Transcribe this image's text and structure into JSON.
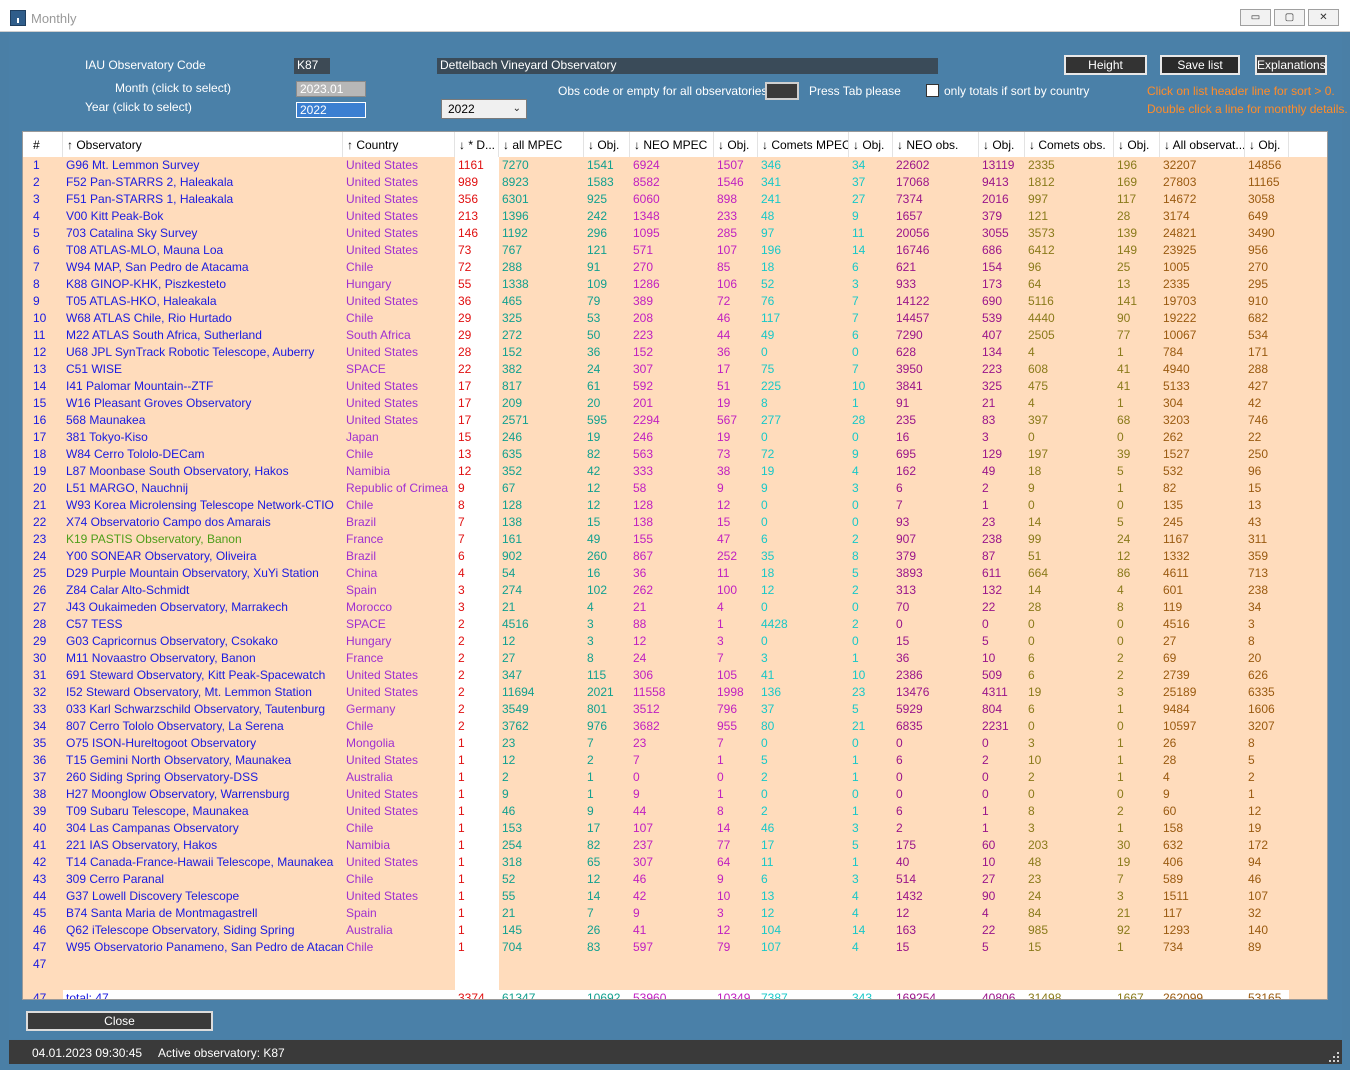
{
  "window": {
    "title": "Monthly",
    "min": "▭",
    "max": "▢",
    "close": "✕"
  },
  "form": {
    "code_label": "IAU Observatory Code",
    "code_value": "K87",
    "observatory_name": "Dettelbach Vineyard Observatory",
    "month_label": "Month (click to select)",
    "month_value": "2023.01",
    "year_label": "Year (click to select)",
    "year_value": "2022",
    "year_select": "2022",
    "obs_code_label": "Obs code or empty for all observatories",
    "press_tab": "Press Tab please",
    "totals_checkbox_label": "only totals if sort by country",
    "height_btn": "Height",
    "save_btn": "Save list",
    "explain_btn": "Explanations",
    "hint1": "Click on list header line for sort > 0.",
    "hint2": "Double click a line for monthly details."
  },
  "colors": {
    "row_bg": "#ffdcbc",
    "window_bg": "#4a80a8",
    "hint": "#ff8c2a"
  },
  "table": {
    "headers": [
      "#",
      "↑ Observatory",
      "↑ Country",
      "↓ * D...",
      "↓ all MPEC",
      "↓ Obj.",
      "↓ NEO MPEC",
      "↓ Obj.",
      "↓ Comets MPEC",
      "↓ Obj.",
      "↓ NEO obs.",
      "↓ Obj.",
      "↓ Comets obs.",
      "↓ Obj.",
      "↓ All observat...",
      "↓ Obj."
    ],
    "rows": [
      [
        "1",
        "G96  Mt. Lemmon Survey",
        "United States",
        "1161",
        "7270",
        "1541",
        "6924",
        "1507",
        "346",
        "34",
        "22602",
        "13119",
        "2335",
        "196",
        "32207",
        "14856"
      ],
      [
        "2",
        "F52  Pan-STARRS 2, Haleakala",
        "United States",
        "989",
        "8923",
        "1583",
        "8582",
        "1546",
        "341",
        "37",
        "17068",
        "9413",
        "1812",
        "169",
        "27803",
        "11165"
      ],
      [
        "3",
        "F51  Pan-STARRS 1, Haleakala",
        "United States",
        "356",
        "6301",
        "925",
        "6060",
        "898",
        "241",
        "27",
        "7374",
        "2016",
        "997",
        "117",
        "14672",
        "3058"
      ],
      [
        "4",
        "V00  Kitt Peak-Bok",
        "United States",
        "213",
        "1396",
        "242",
        "1348",
        "233",
        "48",
        "9",
        "1657",
        "379",
        "121",
        "28",
        "3174",
        "649"
      ],
      [
        "5",
        "703  Catalina Sky Survey",
        "United States",
        "146",
        "1192",
        "296",
        "1095",
        "285",
        "97",
        "11",
        "20056",
        "3055",
        "3573",
        "139",
        "24821",
        "3490"
      ],
      [
        "6",
        "T08  ATLAS-MLO, Mauna Loa",
        "United States",
        "73",
        "767",
        "121",
        "571",
        "107",
        "196",
        "14",
        "16746",
        "686",
        "6412",
        "149",
        "23925",
        "956"
      ],
      [
        "7",
        "W94  MAP, San Pedro de Atacama",
        "Chile",
        "72",
        "288",
        "91",
        "270",
        "85",
        "18",
        "6",
        "621",
        "154",
        "96",
        "25",
        "1005",
        "270"
      ],
      [
        "8",
        "K88  GINOP-KHK, Piszkesteto",
        "Hungary",
        "55",
        "1338",
        "109",
        "1286",
        "106",
        "52",
        "3",
        "933",
        "173",
        "64",
        "13",
        "2335",
        "295"
      ],
      [
        "9",
        "T05  ATLAS-HKO, Haleakala",
        "United States",
        "36",
        "465",
        "79",
        "389",
        "72",
        "76",
        "7",
        "14122",
        "690",
        "5116",
        "141",
        "19703",
        "910"
      ],
      [
        "10",
        "W68  ATLAS Chile, Rio Hurtado",
        "Chile",
        "29",
        "325",
        "53",
        "208",
        "46",
        "117",
        "7",
        "14457",
        "539",
        "4440",
        "90",
        "19222",
        "682"
      ],
      [
        "11",
        "M22  ATLAS South Africa, Sutherland",
        "South Africa",
        "29",
        "272",
        "50",
        "223",
        "44",
        "49",
        "6",
        "7290",
        "407",
        "2505",
        "77",
        "10067",
        "534"
      ],
      [
        "12",
        "U68  JPL SynTrack Robotic Telescope, Auberry",
        "United States",
        "28",
        "152",
        "36",
        "152",
        "36",
        "0",
        "0",
        "628",
        "134",
        "4",
        "1",
        "784",
        "171"
      ],
      [
        "13",
        "C51  WISE",
        "SPACE",
        "22",
        "382",
        "24",
        "307",
        "17",
        "75",
        "7",
        "3950",
        "223",
        "608",
        "41",
        "4940",
        "288"
      ],
      [
        "14",
        "I41  Palomar Mountain--ZTF",
        "United States",
        "17",
        "817",
        "61",
        "592",
        "51",
        "225",
        "10",
        "3841",
        "325",
        "475",
        "41",
        "5133",
        "427"
      ],
      [
        "15",
        "W16  Pleasant Groves Observatory",
        "United States",
        "17",
        "209",
        "20",
        "201",
        "19",
        "8",
        "1",
        "91",
        "21",
        "4",
        "1",
        "304",
        "42"
      ],
      [
        "16",
        "568  Maunakea",
        "United States",
        "17",
        "2571",
        "595",
        "2294",
        "567",
        "277",
        "28",
        "235",
        "83",
        "397",
        "68",
        "3203",
        "746"
      ],
      [
        "17",
        "381  Tokyo-Kiso",
        "Japan",
        "15",
        "246",
        "19",
        "246",
        "19",
        "0",
        "0",
        "16",
        "3",
        "0",
        "0",
        "262",
        "22"
      ],
      [
        "18",
        "W84  Cerro Tololo-DECam",
        "Chile",
        "13",
        "635",
        "82",
        "563",
        "73",
        "72",
        "9",
        "695",
        "129",
        "197",
        "39",
        "1527",
        "250"
      ],
      [
        "19",
        "L87  Moonbase South Observatory, Hakos",
        "Namibia",
        "12",
        "352",
        "42",
        "333",
        "38",
        "19",
        "4",
        "162",
        "49",
        "18",
        "5",
        "532",
        "96"
      ],
      [
        "20",
        "L51  MARGO, Nauchnij",
        "Republic of Crimea",
        "9",
        "67",
        "12",
        "58",
        "9",
        "9",
        "3",
        "6",
        "2",
        "9",
        "1",
        "82",
        "15"
      ],
      [
        "21",
        "W93  Korea Microlensing Telescope Network-CTIO",
        "Chile",
        "8",
        "128",
        "12",
        "128",
        "12",
        "0",
        "0",
        "7",
        "1",
        "0",
        "0",
        "135",
        "13"
      ],
      [
        "22",
        "X74  Observatorio Campo dos Amarais",
        "Brazil",
        "7",
        "138",
        "15",
        "138",
        "15",
        "0",
        "0",
        "93",
        "23",
        "14",
        "5",
        "245",
        "43"
      ],
      [
        "23",
        "K19  PASTIS Observatory, Banon",
        "France",
        "7",
        "161",
        "49",
        "155",
        "47",
        "6",
        "2",
        "907",
        "238",
        "99",
        "24",
        "1167",
        "311"
      ],
      [
        "24",
        "Y00  SONEAR Observatory, Oliveira",
        "Brazil",
        "6",
        "902",
        "260",
        "867",
        "252",
        "35",
        "8",
        "379",
        "87",
        "51",
        "12",
        "1332",
        "359"
      ],
      [
        "25",
        "D29  Purple Mountain Observatory, XuYi Station",
        "China",
        "4",
        "54",
        "16",
        "36",
        "11",
        "18",
        "5",
        "3893",
        "611",
        "664",
        "86",
        "4611",
        "713"
      ],
      [
        "26",
        "Z84  Calar Alto-Schmidt",
        "Spain",
        "3",
        "274",
        "102",
        "262",
        "100",
        "12",
        "2",
        "313",
        "132",
        "14",
        "4",
        "601",
        "238"
      ],
      [
        "27",
        "J43  Oukaimeden Observatory, Marrakech",
        "Morocco",
        "3",
        "21",
        "4",
        "21",
        "4",
        "0",
        "0",
        "70",
        "22",
        "28",
        "8",
        "119",
        "34"
      ],
      [
        "28",
        "C57  TESS",
        "SPACE",
        "2",
        "4516",
        "3",
        "88",
        "1",
        "4428",
        "2",
        "0",
        "0",
        "0",
        "0",
        "4516",
        "3"
      ],
      [
        "29",
        "G03  Capricornus Observatory, Csokako",
        "Hungary",
        "2",
        "12",
        "3",
        "12",
        "3",
        "0",
        "0",
        "15",
        "5",
        "0",
        "0",
        "27",
        "8"
      ],
      [
        "30",
        "M11  Novaastro Observatory, Banon",
        "France",
        "2",
        "27",
        "8",
        "24",
        "7",
        "3",
        "1",
        "36",
        "10",
        "6",
        "2",
        "69",
        "20"
      ],
      [
        "31",
        "691  Steward Observatory, Kitt Peak-Spacewatch",
        "United States",
        "2",
        "347",
        "115",
        "306",
        "105",
        "41",
        "10",
        "2386",
        "509",
        "6",
        "2",
        "2739",
        "626"
      ],
      [
        "32",
        "I52  Steward Observatory, Mt. Lemmon Station",
        "United States",
        "2",
        "11694",
        "2021",
        "11558",
        "1998",
        "136",
        "23",
        "13476",
        "4311",
        "19",
        "3",
        "25189",
        "6335"
      ],
      [
        "33",
        "033  Karl Schwarzschild Observatory, Tautenburg",
        "Germany",
        "2",
        "3549",
        "801",
        "3512",
        "796",
        "37",
        "5",
        "5929",
        "804",
        "6",
        "1",
        "9484",
        "1606"
      ],
      [
        "34",
        "807  Cerro Tololo Observatory, La Serena",
        "Chile",
        "2",
        "3762",
        "976",
        "3682",
        "955",
        "80",
        "21",
        "6835",
        "2231",
        "0",
        "0",
        "10597",
        "3207"
      ],
      [
        "35",
        "O75  ISON-Hureltogoot Observatory",
        "Mongolia",
        "1",
        "23",
        "7",
        "23",
        "7",
        "0",
        "0",
        "0",
        "0",
        "3",
        "1",
        "26",
        "8"
      ],
      [
        "36",
        "T15  Gemini North Observatory, Maunakea",
        "United States",
        "1",
        "12",
        "2",
        "7",
        "1",
        "5",
        "1",
        "6",
        "2",
        "10",
        "1",
        "28",
        "5"
      ],
      [
        "37",
        "260  Siding Spring Observatory-DSS",
        "Australia",
        "1",
        "2",
        "1",
        "0",
        "0",
        "2",
        "1",
        "0",
        "0",
        "2",
        "1",
        "4",
        "2"
      ],
      [
        "38",
        "H27  Moonglow Observatory, Warrensburg",
        "United States",
        "1",
        "9",
        "1",
        "9",
        "1",
        "0",
        "0",
        "0",
        "0",
        "0",
        "0",
        "9",
        "1"
      ],
      [
        "39",
        "T09  Subaru Telescope, Maunakea",
        "United States",
        "1",
        "46",
        "9",
        "44",
        "8",
        "2",
        "1",
        "6",
        "1",
        "8",
        "2",
        "60",
        "12"
      ],
      [
        "40",
        "304  Las Campanas Observatory",
        "Chile",
        "1",
        "153",
        "17",
        "107",
        "14",
        "46",
        "3",
        "2",
        "1",
        "3",
        "1",
        "158",
        "19"
      ],
      [
        "41",
        "221  IAS Observatory, Hakos",
        "Namibia",
        "1",
        "254",
        "82",
        "237",
        "77",
        "17",
        "5",
        "175",
        "60",
        "203",
        "30",
        "632",
        "172"
      ],
      [
        "42",
        "T14  Canada-France-Hawaii Telescope, Maunakea",
        "United States",
        "1",
        "318",
        "65",
        "307",
        "64",
        "11",
        "1",
        "40",
        "10",
        "48",
        "19",
        "406",
        "94"
      ],
      [
        "43",
        "309  Cerro Paranal",
        "Chile",
        "1",
        "52",
        "12",
        "46",
        "9",
        "6",
        "3",
        "514",
        "27",
        "23",
        "7",
        "589",
        "46"
      ],
      [
        "44",
        "G37  Lowell Discovery Telescope",
        "United States",
        "1",
        "55",
        "14",
        "42",
        "10",
        "13",
        "4",
        "1432",
        "90",
        "24",
        "3",
        "1511",
        "107"
      ],
      [
        "45",
        "B74  Santa Maria de Montmagastrell",
        "Spain",
        "1",
        "21",
        "7",
        "9",
        "3",
        "12",
        "4",
        "12",
        "4",
        "84",
        "21",
        "117",
        "32"
      ],
      [
        "46",
        "Q62  iTelescope Observatory, Siding Spring",
        "Australia",
        "1",
        "145",
        "26",
        "41",
        "12",
        "104",
        "14",
        "163",
        "22",
        "985",
        "92",
        "1293",
        "140"
      ],
      [
        "47",
        "W95  Observatorio Panameno, San Pedro de Atacama",
        "Chile",
        "1",
        "704",
        "83",
        "597",
        "79",
        "107",
        "4",
        "15",
        "5",
        "15",
        "1",
        "734",
        "89"
      ]
    ],
    "blank_row_num": "47",
    "total_row": [
      "47",
      "total: 47",
      "",
      "3374",
      "61347",
      "10692",
      "53960",
      "10349",
      "7387",
      "343",
      "169254",
      "40806",
      "31498",
      "1667",
      "262099",
      "53165"
    ]
  },
  "close_btn": "Close",
  "status": {
    "datetime": "04.01.2023 09:30:45",
    "active": "Active observatory: K87"
  }
}
